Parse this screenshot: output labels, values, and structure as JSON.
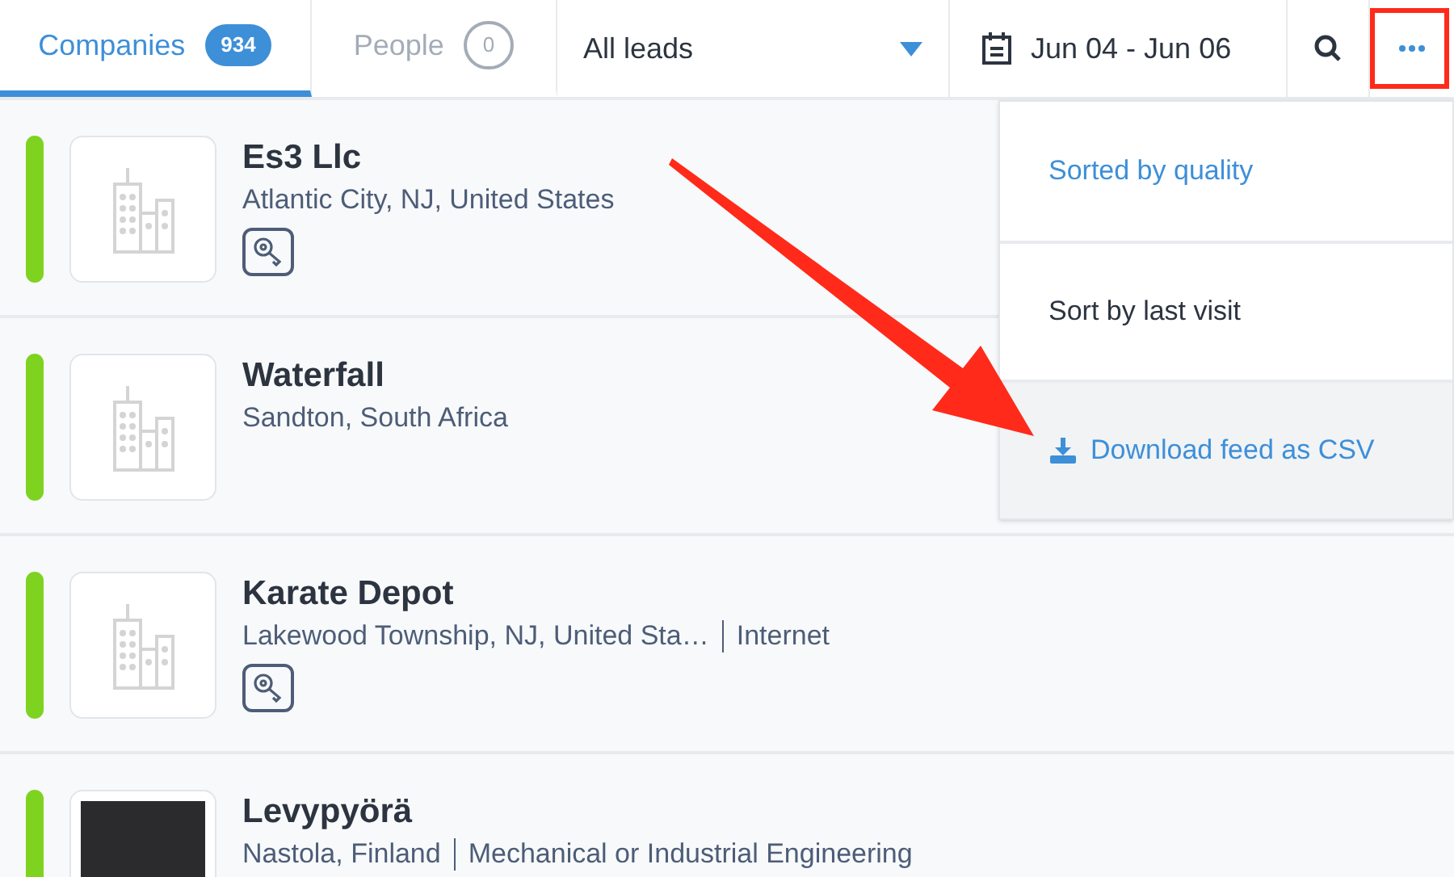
{
  "tabs": [
    {
      "label": "Companies",
      "count": "934",
      "selected": true
    },
    {
      "label": "People",
      "count": "0",
      "selected": false
    }
  ],
  "filter": {
    "value": "All leads"
  },
  "date_range": {
    "value": "Jun 04 - Jun 06"
  },
  "companies": [
    {
      "name": "Es3 Llc",
      "location": "Atlantic City, NJ, United States",
      "key_badge": true,
      "kind": "building"
    },
    {
      "name": "Waterfall",
      "location": "Sandton, South Africa",
      "key_badge": false,
      "kind": "building"
    },
    {
      "name": "Karate Depot",
      "location": "Lakewood Township, NJ, United Sta…",
      "industry": "Internet",
      "key_badge": true,
      "kind": "building"
    },
    {
      "name": "Levypyörä",
      "location": "Nastola, Finland",
      "industry": "Mechanical or Industrial Engineering",
      "key_badge": false,
      "kind": "photo"
    }
  ],
  "menu": [
    {
      "label": "Sorted by quality",
      "kind": "sort",
      "selected": true,
      "highlighted": false
    },
    {
      "label": "Sort by last visit",
      "kind": "sort",
      "selected": false,
      "highlighted": false
    },
    {
      "label": "Download feed as CSV",
      "kind": "download",
      "highlighted": true
    }
  ],
  "annotations": {
    "arrow": true,
    "highlight_more_button": true
  }
}
